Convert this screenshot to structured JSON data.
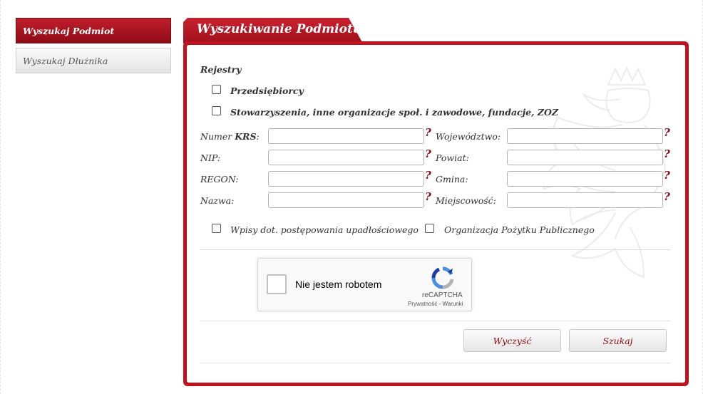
{
  "sidebar": {
    "items": [
      {
        "label": "Wyszukaj Podmiot",
        "active": true
      },
      {
        "label": "Wyszukaj Dłużnika",
        "active": false
      }
    ]
  },
  "panel": {
    "title": "Wyszukiwanie Podmiotu",
    "registries_label": "Rejestry",
    "registry_options": [
      {
        "label": "Przedsiębiorcy",
        "checked": false
      },
      {
        "label": "Stowarzyszenia, inne organizacje społ. i zawodowe, fundacje, ZOZ",
        "checked": false
      }
    ],
    "fields_left": [
      {
        "label_prefix": "Numer ",
        "label_bold": "KRS",
        "label_suffix": ":",
        "value": ""
      },
      {
        "label": "NIP:",
        "value": ""
      },
      {
        "label": "REGON:",
        "value": ""
      },
      {
        "label": "Nazwa:",
        "value": ""
      }
    ],
    "fields_right": [
      {
        "label": "Województwo:",
        "value": ""
      },
      {
        "label": "Powiat:",
        "value": ""
      },
      {
        "label": "Gmina:",
        "value": ""
      },
      {
        "label": "Miejscowość:",
        "value": ""
      }
    ],
    "help_glyph": "?",
    "extra_options": [
      {
        "label": "Wpisy dot. postępowania upadłościowego",
        "checked": false
      },
      {
        "label": "Organizacja Pożytku Publicznego",
        "checked": false
      }
    ],
    "captcha": {
      "label": "Nie jestem robotem",
      "brand": "reCAPTCHA",
      "links": "Prywatność - Warunki"
    },
    "buttons": {
      "clear": "Wyczyść",
      "search": "Szukaj"
    }
  },
  "colors": {
    "brand_red": "#c0131f",
    "dark_red": "#8e0b16"
  }
}
